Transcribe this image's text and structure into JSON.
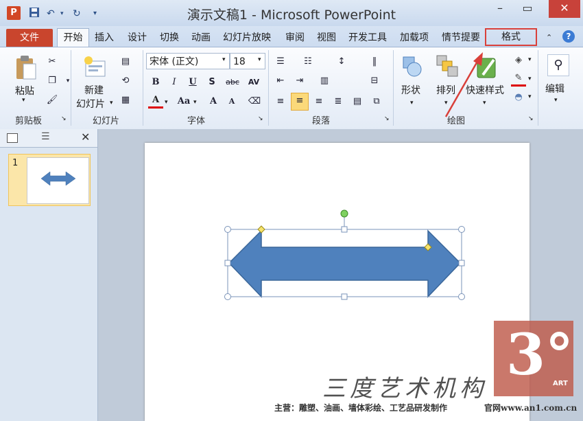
{
  "window": {
    "title": "演示文稿1 - Microsoft PowerPoint",
    "app_icon": "P"
  },
  "qat": {
    "save_icon": "save-icon",
    "undo_icon": "undo-icon",
    "redo_icon": "redo-icon"
  },
  "tabs": {
    "file": "文件",
    "home": "开始",
    "insert": "插入",
    "design": "设计",
    "transitions": "切换",
    "animations": "动画",
    "slideshow": "幻灯片放映",
    "review": "审阅",
    "view": "视图",
    "developer": "开发工具",
    "addins": "加载项",
    "storyboard": "情节提要",
    "format": "格式"
  },
  "ribbon": {
    "clipboard": {
      "paste": "粘贴",
      "label": "剪贴板"
    },
    "slides": {
      "new_slide_line1": "新建",
      "new_slide_line2": "幻灯片",
      "label": "幻灯片"
    },
    "font": {
      "font_name": "宋体 (正文)",
      "font_size": "18",
      "label": "字体",
      "bold": "B",
      "italic": "I",
      "underline": "U",
      "shadow": "S",
      "strike": "abc",
      "spacing": "AV",
      "color": "A",
      "case": "Aa",
      "grow": "A",
      "shrink": "A"
    },
    "paragraph": {
      "label": "段落"
    },
    "drawing": {
      "shapes": "形状",
      "arrange": "排列",
      "quick_styles": "快速样式",
      "label": "绘图"
    },
    "editing": {
      "label": "编辑"
    }
  },
  "slides_pane": {
    "slide_number": "1"
  },
  "watermark": {
    "brand_cn": "三度艺术机构",
    "footer": "主营：雕塑、油画、墙体彩绘、工艺品研发制作",
    "site": "官网www.an1.com.cn",
    "logo_text": "3°",
    "logo_sub": "ART"
  },
  "colors": {
    "accent_red": "#d9403a",
    "shape_fill": "#4f81bd",
    "file_tab": "#c9452d"
  }
}
